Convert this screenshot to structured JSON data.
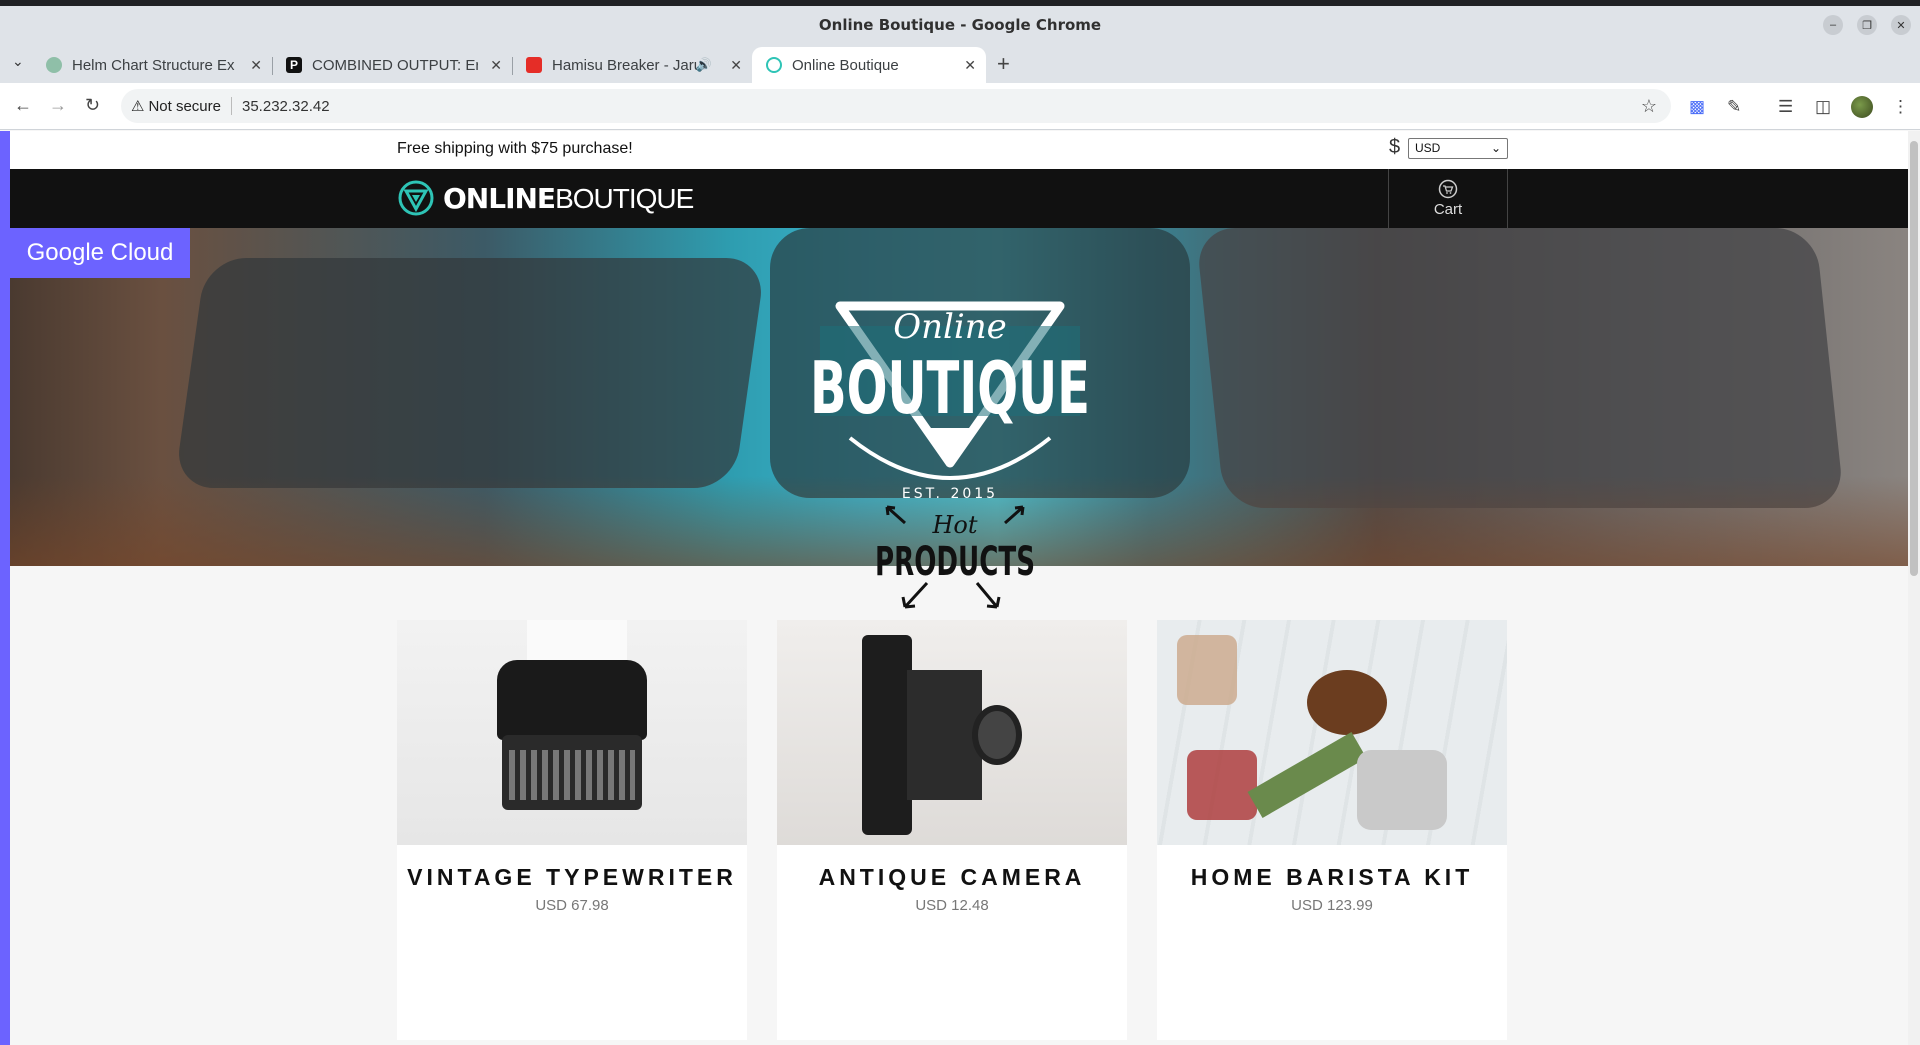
{
  "window": {
    "title": "Online Boutique - Google Chrome"
  },
  "tabs": [
    {
      "label": "Helm Chart Structure Ex",
      "favicon": "chatgpt-icon",
      "active": false
    },
    {
      "label": "COMBINED OUTPUT: Err",
      "favicon": "perplexity-icon",
      "active": false
    },
    {
      "label": "Hamisu Breaker - Jaru",
      "favicon": "youtube-icon",
      "active": false,
      "audio": true
    },
    {
      "label": "Online Boutique",
      "favicon": "boutique-icon",
      "active": true
    }
  ],
  "omnibox": {
    "security": "Not secure",
    "url": "35.232.32.42"
  },
  "site": {
    "promo_text": "Free shipping with $75 purchase!",
    "currency_symbol": "$",
    "currency_selected": "USD",
    "brand_bold": "ONLINE",
    "brand_light": "BOUTIQUE",
    "cart_label": "Cart",
    "gcloud_label": "Google Cloud",
    "hero_script": "Online",
    "hero_title": "BOUTIQUE",
    "hero_est": "EST. 2015",
    "hot_script": "Hot",
    "hot_title": "PRODUCTS"
  },
  "products": [
    {
      "name": "VINTAGE TYPEWRITER",
      "price": "USD 67.98"
    },
    {
      "name": "ANTIQUE CAMERA",
      "price": "USD 12.48"
    },
    {
      "name": "HOME BARISTA KIT",
      "price": "USD 123.99"
    }
  ],
  "colors": {
    "accent": "#6c63ff",
    "header": "#111111",
    "logo_teal": "#2ec4b6"
  }
}
